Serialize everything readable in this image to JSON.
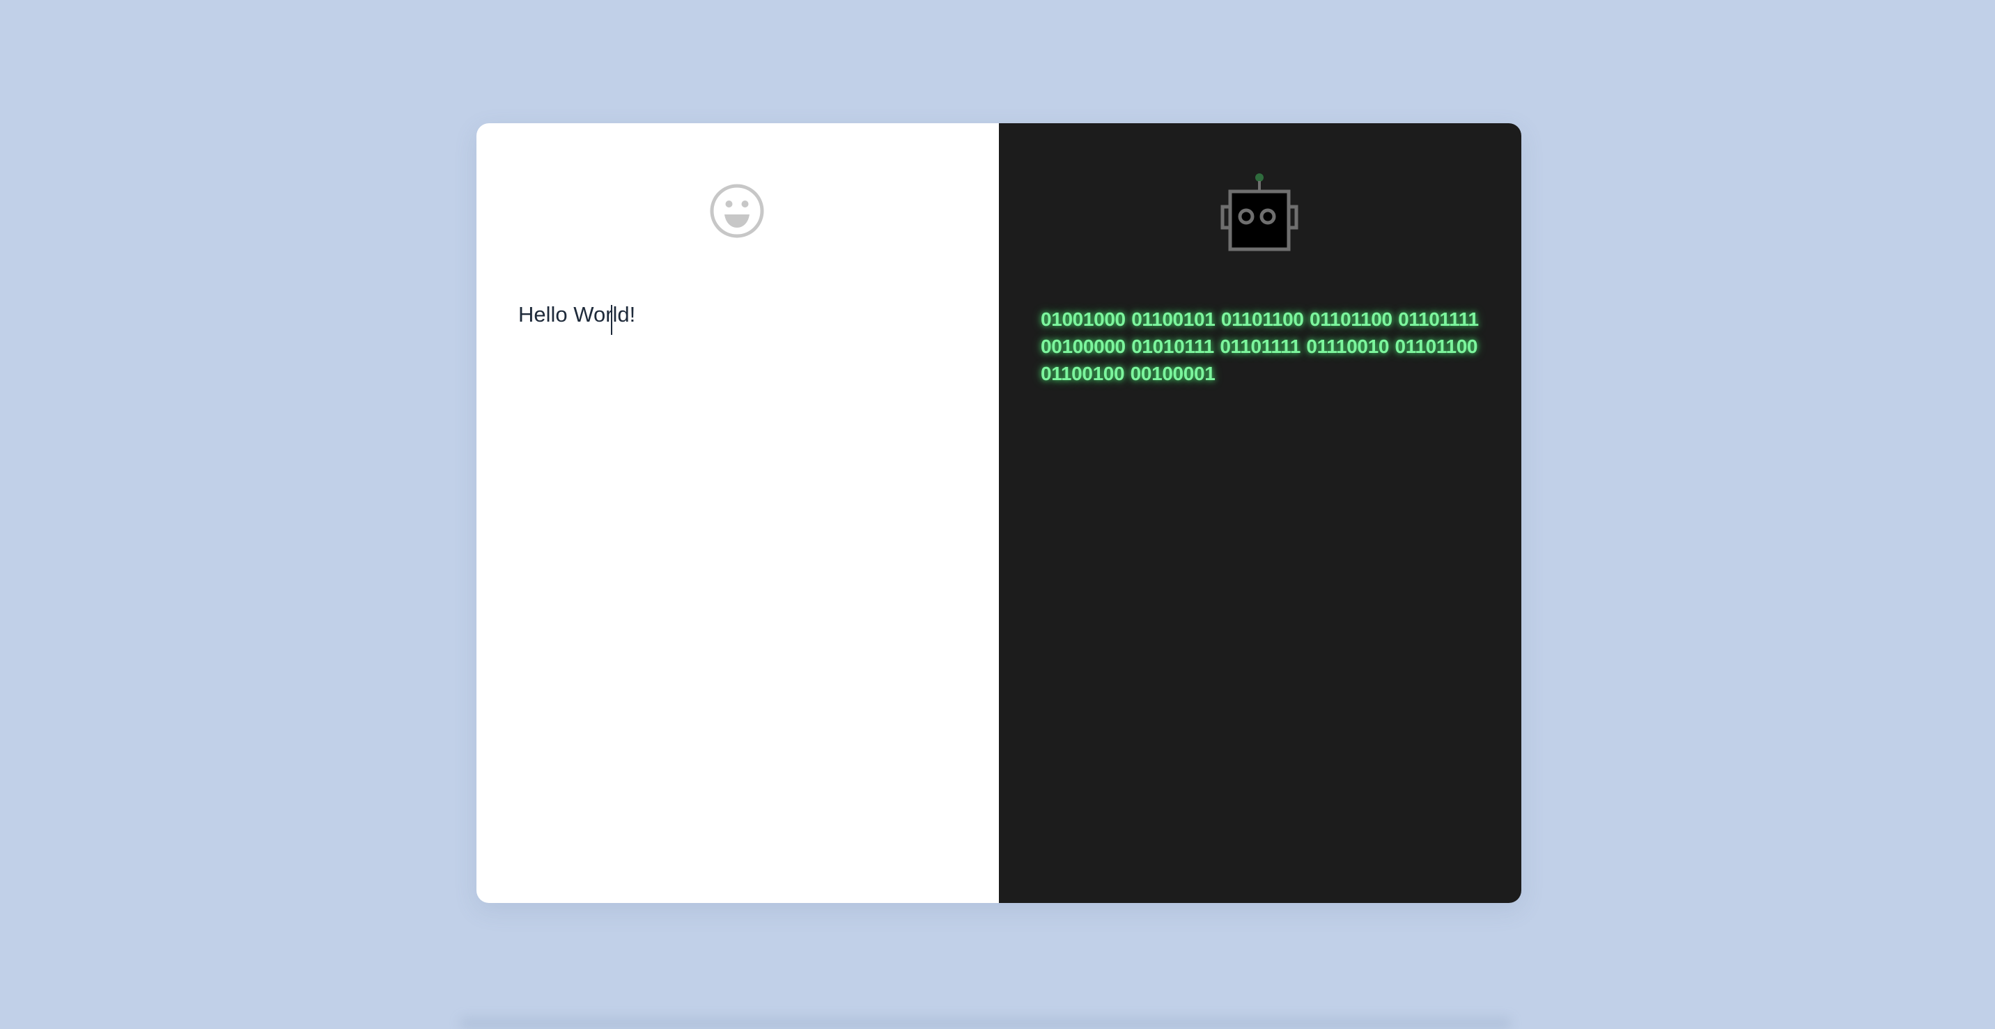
{
  "human_panel": {
    "icon": "smiley-face-icon",
    "text": "Hello World!"
  },
  "robot_panel": {
    "icon": "robot-icon",
    "binary_text": "01001000 01100101 01101100 01101100 01101111 00100000 01010111 01101111 01110010 01101100 01100100 00100001"
  },
  "colors": {
    "page_background": "#c1d0e8",
    "human_background": "#ffffff",
    "robot_background": "#1c1c1c",
    "human_text": "#1e2a3a",
    "binary_text": "#7cf59d",
    "icon_gray": "#c7c7c7",
    "robot_antenna": "#2f6b3d"
  }
}
